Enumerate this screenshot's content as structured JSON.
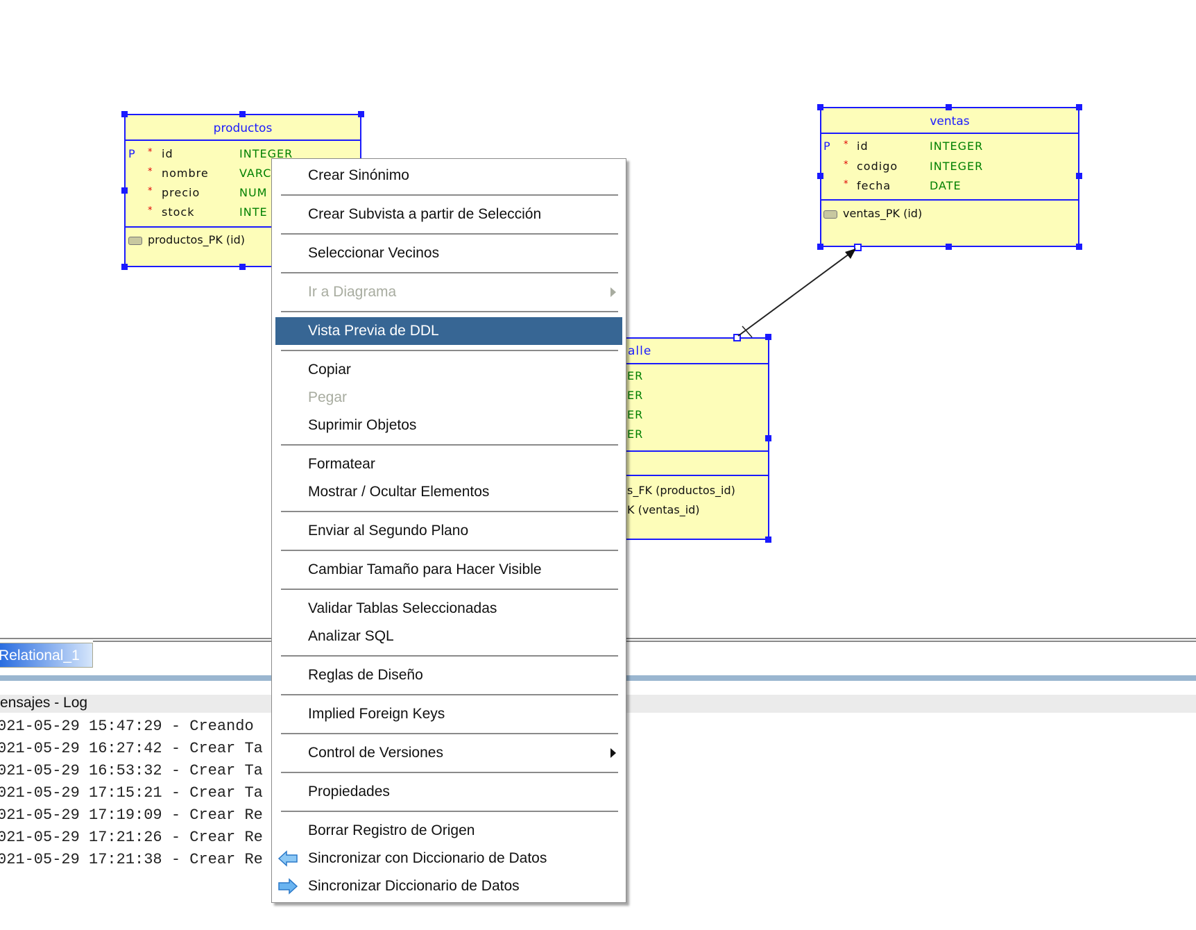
{
  "tables": {
    "productos": {
      "title": "productos",
      "columns": [
        {
          "pk": "P",
          "req": "*",
          "name": "id",
          "type": "INTEGER"
        },
        {
          "pk": "",
          "req": "*",
          "name": "nombre",
          "type": "VARC"
        },
        {
          "pk": "",
          "req": "*",
          "name": "precio",
          "type": "NUM"
        },
        {
          "pk": "",
          "req": "*",
          "name": "stock",
          "type": "INTE"
        }
      ],
      "key": "productos_PK (id)"
    },
    "ventas": {
      "title": "ventas",
      "columns": [
        {
          "pk": "P",
          "req": "*",
          "name": "id",
          "type": "INTEGER"
        },
        {
          "pk": "",
          "req": "*",
          "name": "codigo",
          "type": "INTEGER"
        },
        {
          "pk": "",
          "req": "*",
          "name": "fecha",
          "type": "DATE"
        }
      ],
      "key": "ventas_PK (id)"
    },
    "detalle": {
      "title_fragment": "alle",
      "type_fragments": [
        "ER",
        "ER",
        "ER",
        "ER"
      ],
      "fk_fragments": [
        "s_FK (productos_id)",
        "K (ventas_id)"
      ]
    }
  },
  "context_menu": {
    "items": [
      {
        "label": "Crear Sinónimo"
      },
      {
        "label": "Crear Subvista a partir de Selección"
      },
      {
        "label": "Seleccionar Vecinos"
      },
      {
        "label": "Ir a Diagrama",
        "disabled": true,
        "submenu": true
      },
      {
        "label": "Vista Previa de DDL",
        "highlighted": true
      },
      {
        "label": "Copiar"
      },
      {
        "label": "Pegar",
        "disabled": true
      },
      {
        "label": "Suprimir Objetos"
      },
      {
        "label": "Formatear"
      },
      {
        "label": "Mostrar / Ocultar Elementos"
      },
      {
        "label": "Enviar al Segundo Plano"
      },
      {
        "label": "Cambiar Tamaño para Hacer Visible"
      },
      {
        "label": "Validar Tablas Seleccionadas"
      },
      {
        "label": "Analizar SQL"
      },
      {
        "label": "Reglas de Diseño"
      },
      {
        "label": "Implied Foreign Keys"
      },
      {
        "label": "Control de Versiones",
        "submenu": true
      },
      {
        "label": "Propiedades"
      },
      {
        "label": "Borrar Registro de Origen"
      },
      {
        "label": "Sincronizar con Diccionario de Datos",
        "icon": "arrow-left-icon"
      },
      {
        "label": "Sincronizar Diccionario de Datos",
        "icon": "arrow-right-icon"
      }
    ],
    "highlight_color": "#376694"
  },
  "bottom": {
    "tab": "Relational_1",
    "panel_title": "ensajes - Log",
    "log": [
      "021-05-29 15:47:29 - Creando",
      "021-05-29 16:27:42 - Crear Ta",
      "021-05-29 16:53:32 - Crear Ta",
      "021-05-29 17:15:21 - Crear Ta",
      "021-05-29 17:19:09 - Crear Re",
      "021-05-29 17:21:26 - Crear Re",
      "021-05-29 17:21:38 - Crear Re"
    ]
  },
  "colors": {
    "table_fill": "#fdfdb9",
    "table_border": "#1a1aff",
    "type": "#008000",
    "required": "#e00000"
  }
}
